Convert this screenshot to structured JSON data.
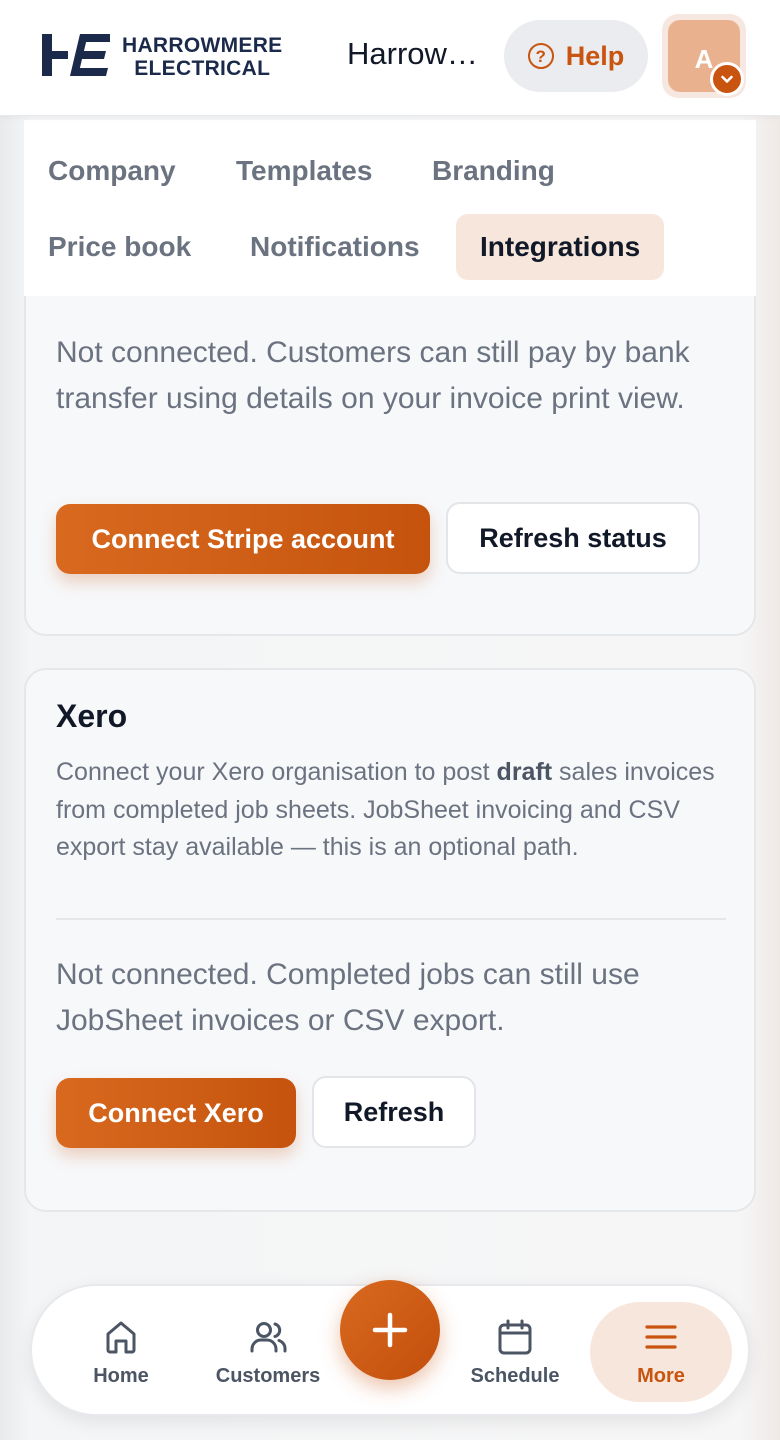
{
  "header": {
    "logo_line1": "HARROWMERE",
    "logo_line2": "ELECTRICAL",
    "title": "Harrowmere Electrical",
    "help_label": "Help",
    "avatar_initial": "A"
  },
  "tabs": [
    {
      "label": "Company",
      "active": false
    },
    {
      "label": "Templates",
      "active": false
    },
    {
      "label": "Branding",
      "active": false
    },
    {
      "label": "Price book",
      "active": false
    },
    {
      "label": "Notifications",
      "active": false
    },
    {
      "label": "Integrations",
      "active": true
    }
  ],
  "stripe": {
    "status": "Not connected. Customers can still pay by bank transfer using details on your invoice print view.",
    "connect_label": "Connect Stripe account",
    "refresh_label": "Refresh status"
  },
  "xero": {
    "title": "Xero",
    "desc_before": "Connect your Xero organisation to post ",
    "desc_bold": "draft",
    "desc_after": " sales invoices from completed job sheets. JobSheet invoicing and CSV export stay available — this is an optional path.",
    "status": "Not connected. Completed jobs can still use JobSheet invoices or CSV export.",
    "connect_label": "Connect Xero",
    "refresh_label": "Refresh"
  },
  "bottom_nav": {
    "home": "Home",
    "customers": "Customers",
    "schedule": "Schedule",
    "more": "More"
  },
  "colors": {
    "accent": "#c8540f",
    "accent_soft": "#f7e6db",
    "text_muted": "#6b7280"
  }
}
